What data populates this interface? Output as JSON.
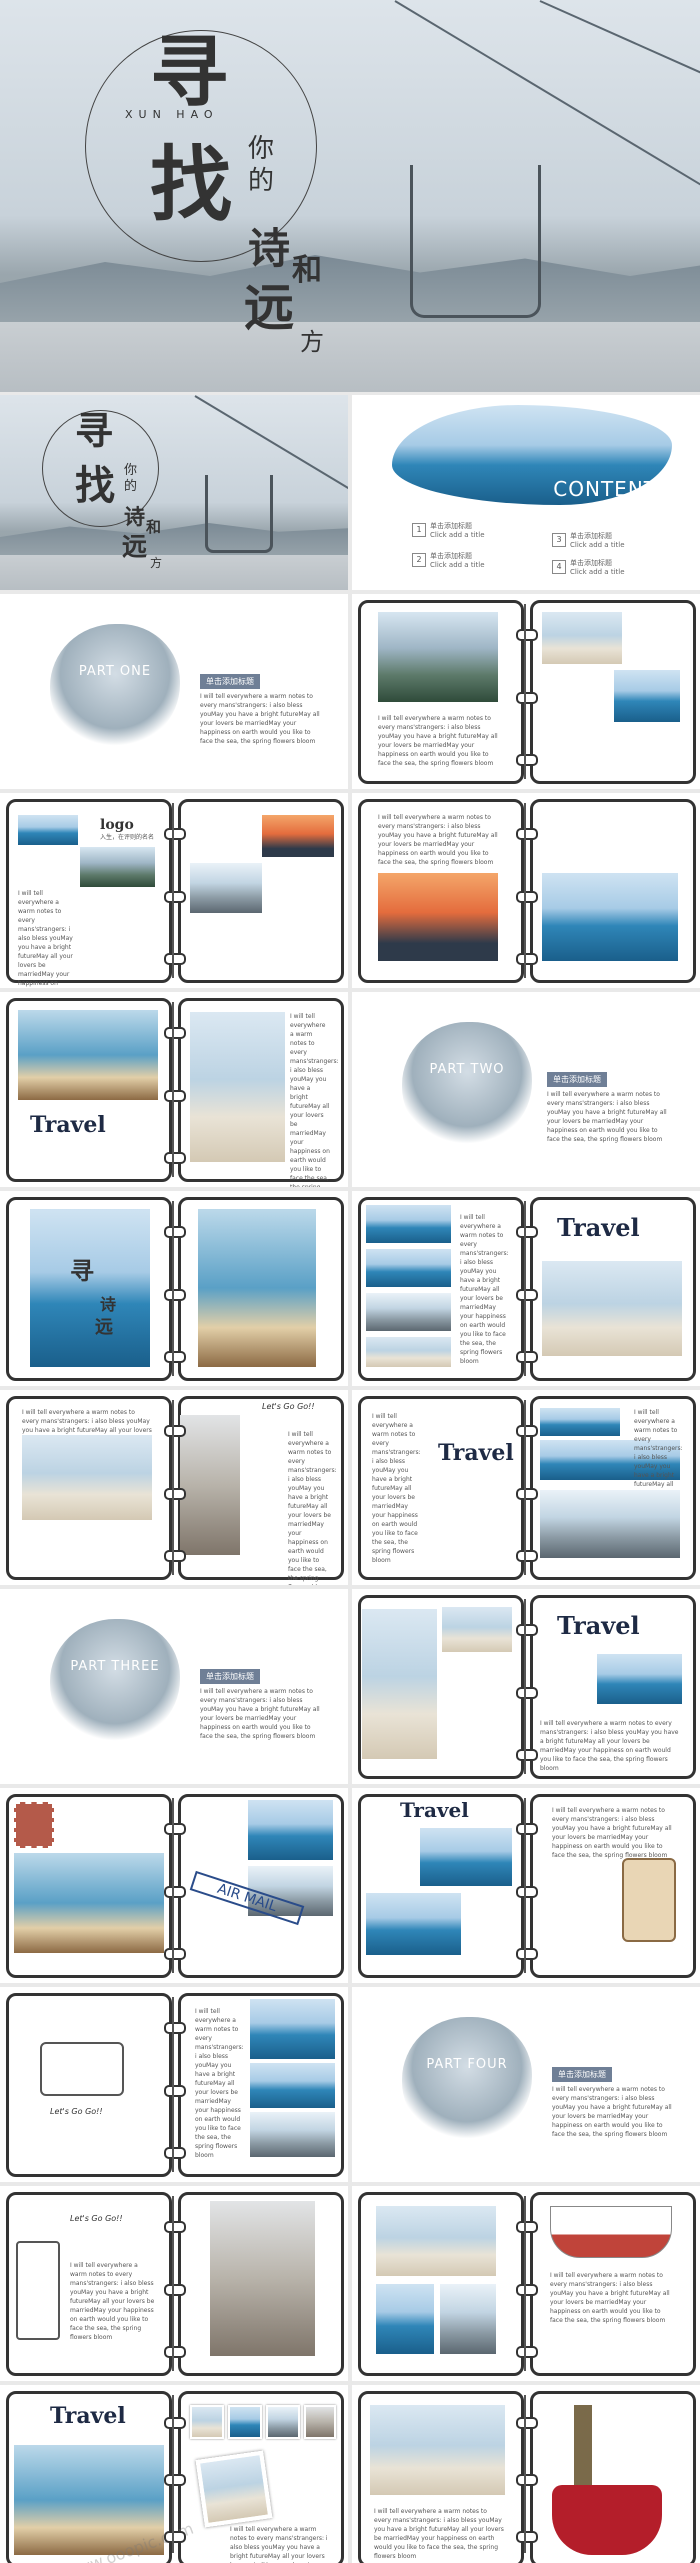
{
  "cover": {
    "title_char1": "寻",
    "title_char2": "找",
    "pinyin": "XUN HAO",
    "small_char1": "你",
    "small_char2": "的",
    "char_shi": "诗",
    "char_he": "和",
    "char_yuan": "远",
    "char_fang": "方"
  },
  "contents": {
    "heading": "CONTENTS",
    "items": [
      {
        "num": "1",
        "title": "单击添加标题",
        "sub": "Click add a title"
      },
      {
        "num": "2",
        "title": "单击添加标题",
        "sub": "Click add a title"
      },
      {
        "num": "3",
        "title": "单击添加标题",
        "sub": "Click add a title"
      },
      {
        "num": "4",
        "title": "单击添加标题",
        "sub": "Click add a title"
      }
    ]
  },
  "parts": {
    "one": "PART ONE",
    "two": "PART TWO",
    "three": "PART THREE",
    "four": "PART FOUR"
  },
  "tag_label": "单击添加标题",
  "body_text": "I will tell everywhere a warm notes to every mans'strangers: i also bless youMay you have a bright futureMay all your lovers be marriedMay your happiness on earth would you like to face the sea, the spring flowers bloom",
  "logo": {
    "title": "logo",
    "subtitle": "入生，在评则的名名"
  },
  "travel_word": "Travel",
  "lets_go": "Let's Go Go!!",
  "air_mail": "AIR MAIL",
  "watermark": "www.ooopic.com"
}
